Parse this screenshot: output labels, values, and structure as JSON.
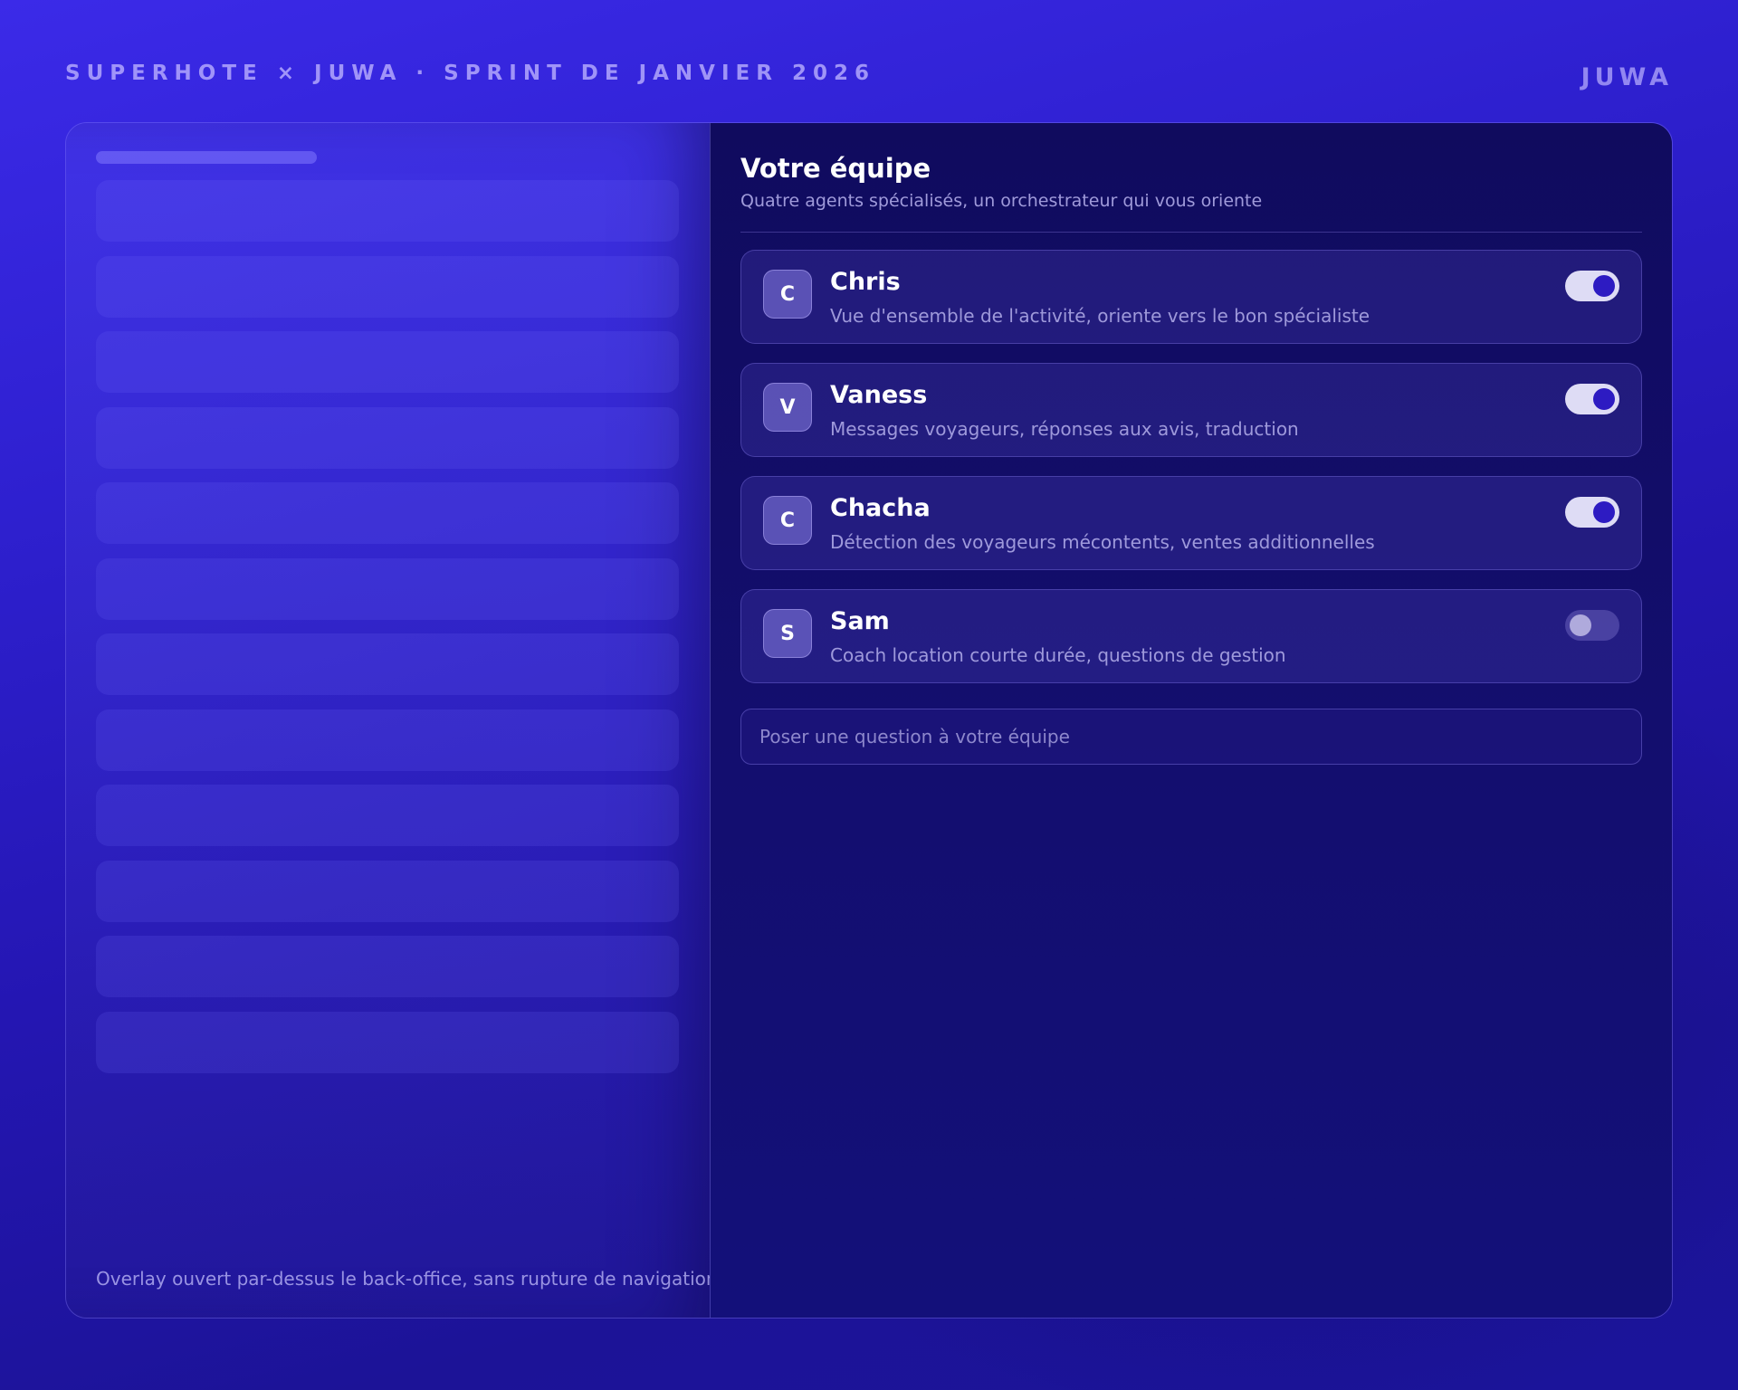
{
  "header": {
    "title": "SUPERHOTE × JUWA · SPRINT DE JANVIER 2026",
    "brand": "JUWA"
  },
  "backoffice": {
    "caption": "Overlay ouvert par-dessus le back-office, sans rupture de navigation"
  },
  "panel": {
    "title": "Votre équipe",
    "subtitle": "Quatre agents spécialisés, un orchestrateur qui vous oriente",
    "agents": [
      {
        "initial": "C",
        "name": "Chris",
        "description": "Vue d'ensemble de l'activité, oriente vers le bon spécialiste",
        "enabled": true
      },
      {
        "initial": "V",
        "name": "Vaness",
        "description": "Messages voyageurs, réponses aux avis, traduction",
        "enabled": true
      },
      {
        "initial": "C",
        "name": "Chacha",
        "description": "Détection des voyageurs mécontents, ventes additionnelles",
        "enabled": true
      },
      {
        "initial": "S",
        "name": "Sam",
        "description": "Coach location courte durée, questions de gestion",
        "enabled": false
      }
    ],
    "ask_placeholder": "Poser une question à votre équipe"
  },
  "colors": {
    "background": "#2e20cf",
    "panel": "#140f6e",
    "toggle_on_track": "#dedcf5",
    "toggle_on_knob": "#2d1bc2"
  }
}
